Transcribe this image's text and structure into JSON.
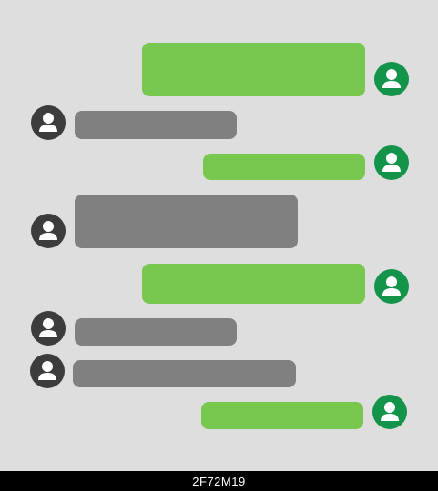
{
  "colors": {
    "background": "#dedede",
    "sent_bubble": "#78c850",
    "received_bubble": "#808080",
    "sent_avatar": "#14944a",
    "received_avatar": "#3c3c3c",
    "avatar_figure": "#ffffff",
    "footer_bg": "#000000"
  },
  "conversation": {
    "messages": [
      {
        "side": "sent",
        "icon": "user-icon"
      },
      {
        "side": "received",
        "icon": "user-icon"
      },
      {
        "side": "sent",
        "icon": "user-icon"
      },
      {
        "side": "received",
        "icon": "user-icon"
      },
      {
        "side": "sent",
        "icon": "user-icon"
      },
      {
        "side": "received",
        "icon": "user-icon"
      },
      {
        "side": "received",
        "icon": "user-icon"
      },
      {
        "side": "sent",
        "icon": "user-icon"
      }
    ]
  },
  "footer": {
    "image_id": "2F72M19"
  }
}
